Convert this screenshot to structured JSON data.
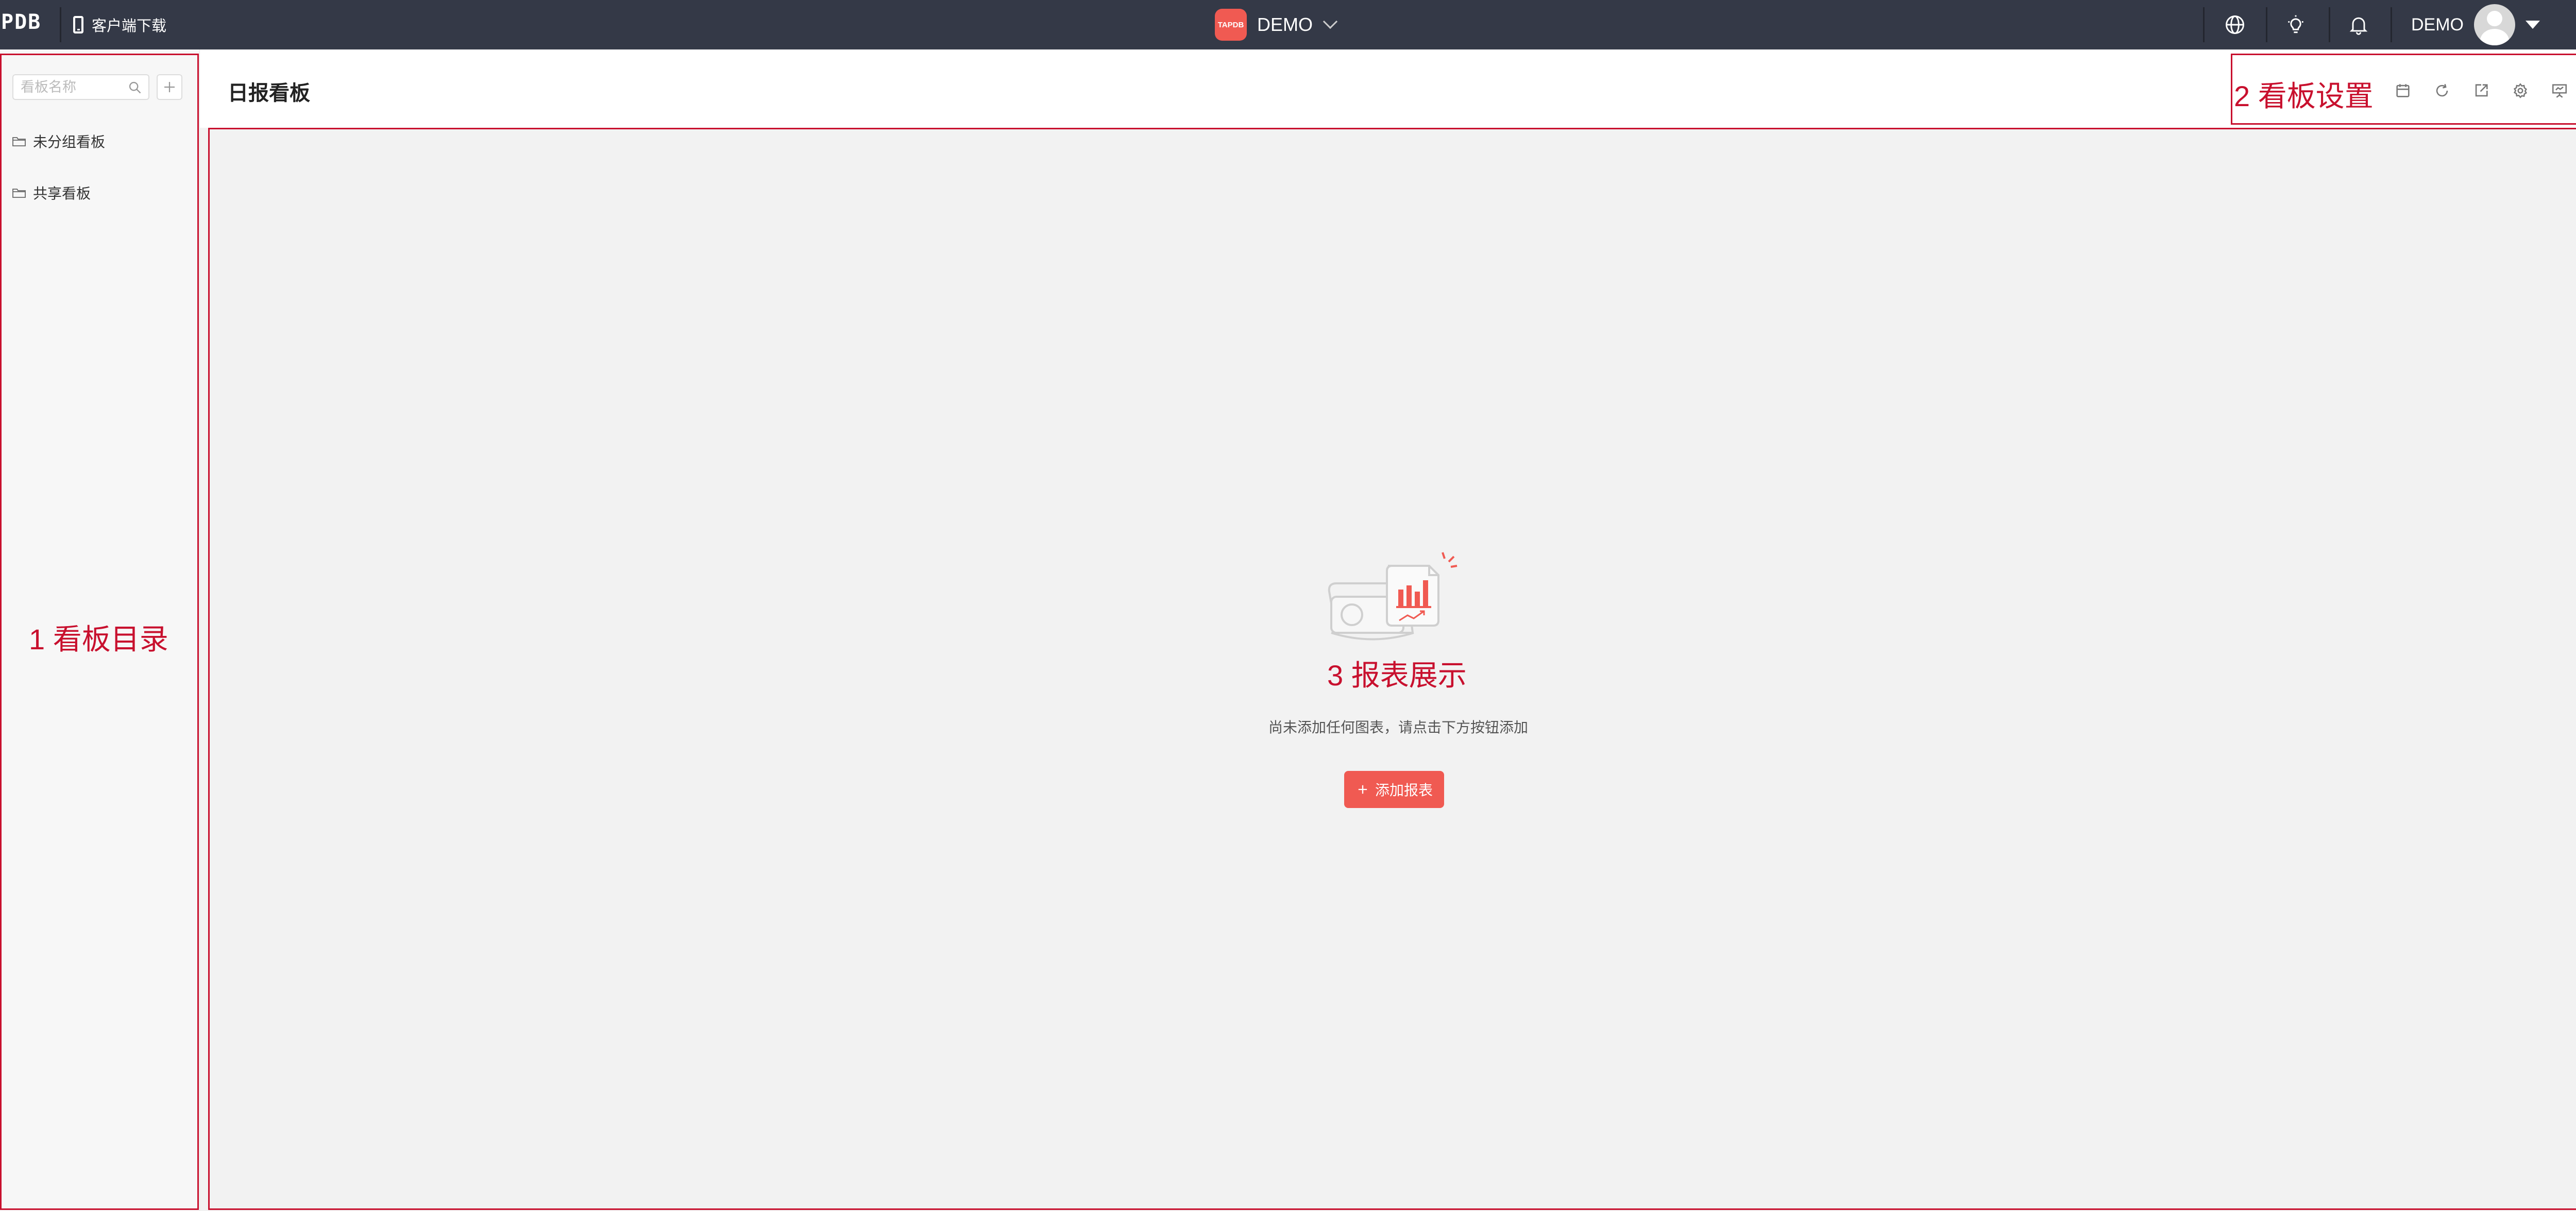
{
  "topbar": {
    "logo": "PDB",
    "download_label": "客户端下载",
    "brand_logo_text": "TAPDB",
    "brand_name": "DEMO",
    "user_name": "DEMO"
  },
  "sidebar": {
    "search_placeholder": "看板名称",
    "folders": [
      {
        "label": "未分组看板"
      },
      {
        "label": "共享看板"
      }
    ]
  },
  "header": {
    "title": "日报看板"
  },
  "main": {
    "empty_text": "尚未添加任何图表，请点击下方按钮添加",
    "add_button_label": "添加报表"
  },
  "annotations": {
    "sidebar": "1 看板目录",
    "settings": "2 看板设置",
    "report": "3 报表展示"
  },
  "colors": {
    "topbar_bg": "#343947",
    "accent": "#f05a52",
    "annotation": "#c8102e"
  }
}
